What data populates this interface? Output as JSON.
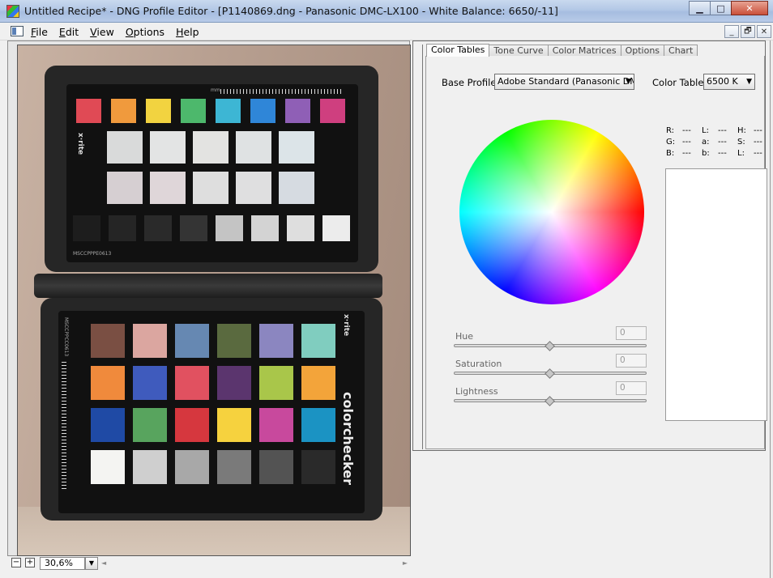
{
  "window": {
    "title": "Untitled Recipe* - DNG Profile Editor - [P1140869.dng  - Panasonic DMC-LX100 - White Balance: 6650/-11]",
    "minimize": "▁",
    "maximize": "□",
    "close": "✕"
  },
  "menu": {
    "items": [
      {
        "label": "File"
      },
      {
        "label": "Edit"
      },
      {
        "label": "View"
      },
      {
        "label": "Options"
      },
      {
        "label": "Help"
      }
    ],
    "mdi": {
      "minimize": "_",
      "restore": "🗗",
      "close": "✕"
    }
  },
  "image_view": {
    "zoom_out": "−",
    "zoom_in": "+",
    "zoom_value": "30,6%",
    "zoom_drop": "▼",
    "scroll_left": "◄",
    "scroll_right": "►"
  },
  "checker": {
    "top_label": "MSCCPPPE0613",
    "bottom_label": "MSCCPPCC0613",
    "brand_logo": "x·rite",
    "brand_big": "colorchecker",
    "ruler_unit": "mm",
    "top_colors": [
      "#e04a55",
      "#f09a3d",
      "#f2d340",
      "#4db86c",
      "#3db6d4",
      "#2f86d8",
      "#8f5fb6",
      "#cf3f7f"
    ],
    "top_grays": [
      "#d9dada",
      "#e3e4e4",
      "#e3e3e1",
      "#dfe2e3",
      "#dce4e8"
    ],
    "mid_grays": [
      "#d6cfd2",
      "#dfd6d9",
      "#dedede",
      "#dfdfe0",
      "#d6dbe1"
    ],
    "dark_row": [
      "#1d1d1d",
      "#252525",
      "#2a2a2a",
      "#343434",
      "#c4c4c4",
      "#d3d3d3",
      "#dedede",
      "#ececec"
    ],
    "classic": [
      "#7a4f43",
      "#dba6a0",
      "#6688b2",
      "#5a6a3f",
      "#8b86c0",
      "#80cdbf",
      "#f08a3c",
      "#3f5bbd",
      "#e15160",
      "#5b356e",
      "#a9c64a",
      "#f3a43a",
      "#1f4aa5",
      "#58a45e",
      "#d6373e",
      "#f6d23e",
      "#c8499d",
      "#1b93c3",
      "#f4f4f2",
      "#cfcfcf",
      "#a8a8a8",
      "#7a7a7a",
      "#535353",
      "#2a2a2a"
    ]
  },
  "panel": {
    "tabs": [
      {
        "label": "Color Tables",
        "active": true
      },
      {
        "label": "Tone Curve",
        "active": false
      },
      {
        "label": "Color Matrices",
        "active": false
      },
      {
        "label": "Options",
        "active": false
      },
      {
        "label": "Chart",
        "active": false
      }
    ],
    "base_profile_label": "Base Profile:",
    "base_profile_value": "Adobe Standard (Panasonic DM",
    "color_table_label": "Color Table:",
    "color_table_value": "6500 K",
    "dropdown_caret": "▼",
    "readouts": [
      [
        {
          "k": "R:",
          "v": "---"
        },
        {
          "k": "L:",
          "v": "---"
        },
        {
          "k": "H:",
          "v": "---"
        }
      ],
      [
        {
          "k": "G:",
          "v": "---"
        },
        {
          "k": "a:",
          "v": "---"
        },
        {
          "k": "S:",
          "v": "---"
        }
      ],
      [
        {
          "k": "B:",
          "v": "---"
        },
        {
          "k": "b:",
          "v": "---"
        },
        {
          "k": "L:",
          "v": "---"
        }
      ]
    ],
    "sliders": [
      {
        "label": "Hue",
        "value": "0",
        "position": 0.5
      },
      {
        "label": "Saturation",
        "value": "0",
        "position": 0.5
      },
      {
        "label": "Lightness",
        "value": "0",
        "position": 0.5
      }
    ]
  }
}
